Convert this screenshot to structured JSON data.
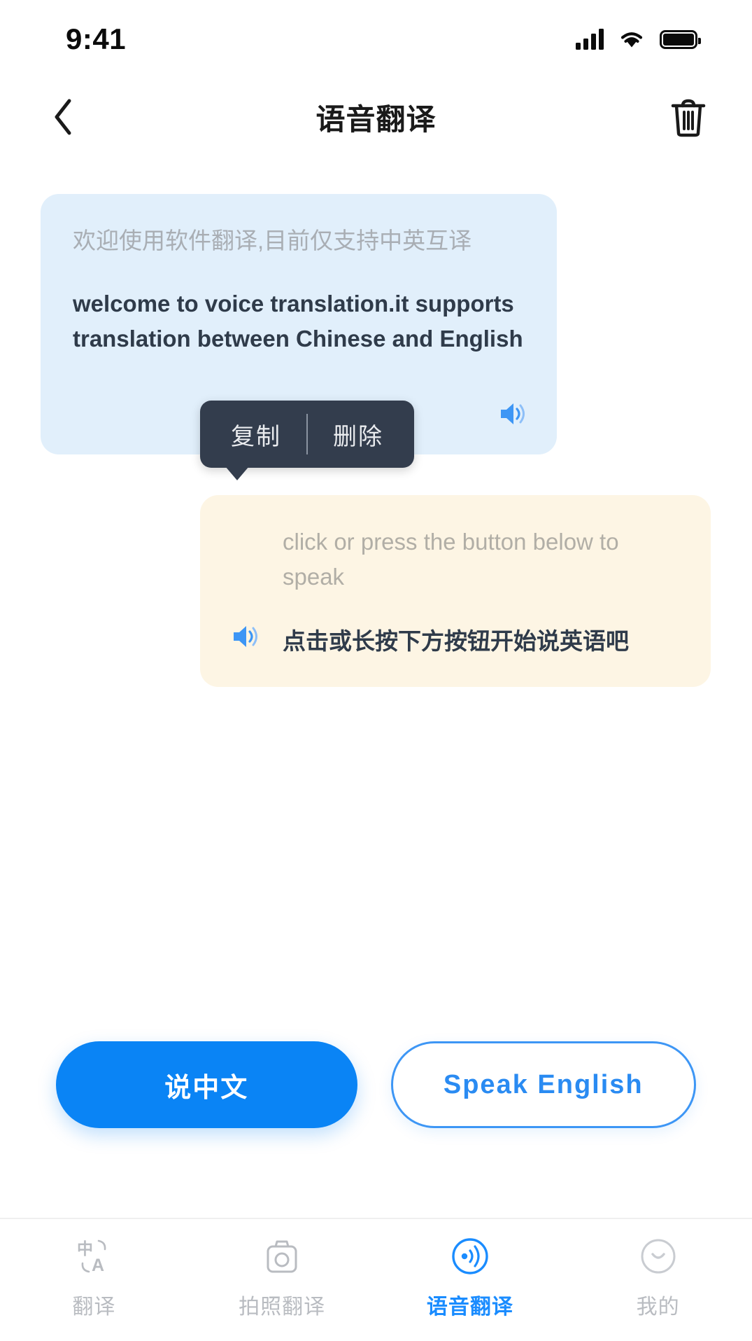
{
  "status_bar": {
    "time": "9:41",
    "signal_icon": "cellular-signal-icon",
    "wifi_icon": "wifi-icon",
    "battery_icon": "battery-icon"
  },
  "header": {
    "back_icon": "back-chevron-icon",
    "title": "语音翻译",
    "delete_icon": "trash-icon"
  },
  "messages": [
    {
      "id": "bubble-left",
      "source_text": "欢迎使用软件翻译,目前仅支持中英互译",
      "translated_text": "welcome to voice translation.it supports translation between Chinese and English",
      "speaker_icon": "speaker-icon",
      "bg_color": "#e1effb"
    },
    {
      "id": "bubble-right",
      "source_text": "click or press the button below to speak",
      "translated_text": "点击或长按下方按钮开始说英语吧",
      "speaker_icon": "speaker-icon",
      "bg_color": "#fdf5e4"
    }
  ],
  "context_menu": {
    "copy_label": "复制",
    "delete_label": "删除",
    "bg_color": "#333d4d"
  },
  "actions": {
    "speak_chinese_label": "说中文",
    "speak_english_label": "Speak English",
    "primary_color": "#0a84f5"
  },
  "tab_bar": {
    "items": [
      {
        "label": "翻译",
        "icon": "text-translate-icon",
        "active": false
      },
      {
        "label": "拍照翻译",
        "icon": "camera-icon",
        "active": false
      },
      {
        "label": "语音翻译",
        "icon": "voice-wave-icon",
        "active": true
      },
      {
        "label": "我的",
        "icon": "profile-smiley-icon",
        "active": false
      }
    ],
    "active_color": "#1a8cff",
    "inactive_color": "#b9bcc1"
  }
}
